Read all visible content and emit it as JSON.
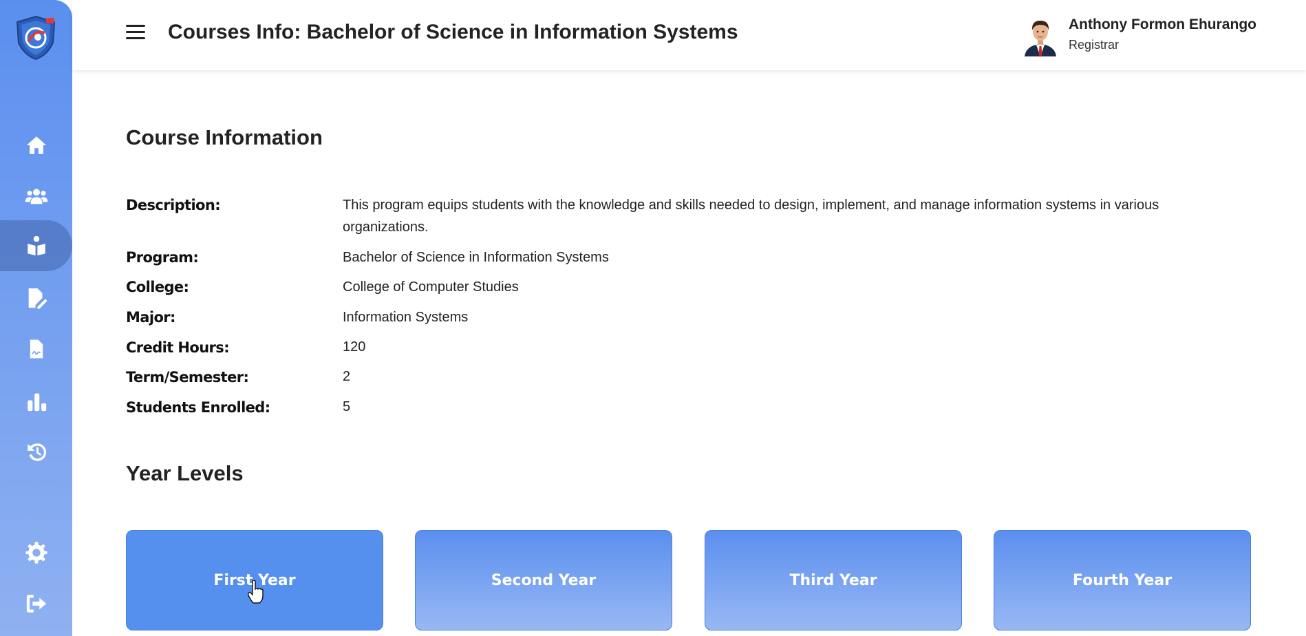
{
  "header": {
    "title": "Courses Info: Bachelor of Science in Information Systems",
    "user_name": "Anthony Formon Ehurango",
    "user_role": "Registrar"
  },
  "sidebar": {
    "items": [
      {
        "name": "home",
        "icon": "home-icon"
      },
      {
        "name": "students",
        "icon": "users-icon"
      },
      {
        "name": "courses",
        "icon": "book-reader-icon",
        "active": true
      },
      {
        "name": "grades",
        "icon": "file-edit-icon"
      },
      {
        "name": "documents",
        "icon": "file-signature-icon"
      },
      {
        "name": "reports",
        "icon": "bar-chart-icon"
      },
      {
        "name": "history",
        "icon": "history-icon"
      },
      {
        "name": "settings",
        "icon": "gear-icon"
      },
      {
        "name": "logout",
        "icon": "logout-icon"
      }
    ],
    "colors": {
      "gradient_top": "#5b8fef",
      "gradient_bottom": "#8fb1f1"
    }
  },
  "course_info": {
    "heading": "Course Information",
    "description_label": "Description:",
    "description": "This program equips students with the knowledge and skills needed to design, implement, and manage information systems in various organizations.",
    "program_label": "Program:",
    "program": "Bachelor of Science in Information Systems",
    "college_label": "College:",
    "college": "College of Computer Studies",
    "major_label": "Major:",
    "major": "Information Systems",
    "credit_hours_label": "Credit Hours:",
    "credit_hours": "120",
    "term_label": "Term/Semester:",
    "term": "2",
    "enrolled_label": "Students Enrolled:",
    "enrolled": "5"
  },
  "year_levels": {
    "heading": "Year Levels",
    "buttons": [
      "First Year",
      "Second Year",
      "Third Year",
      "Fourth Year"
    ],
    "active": "First Year",
    "accent_color": "#5590ee"
  }
}
